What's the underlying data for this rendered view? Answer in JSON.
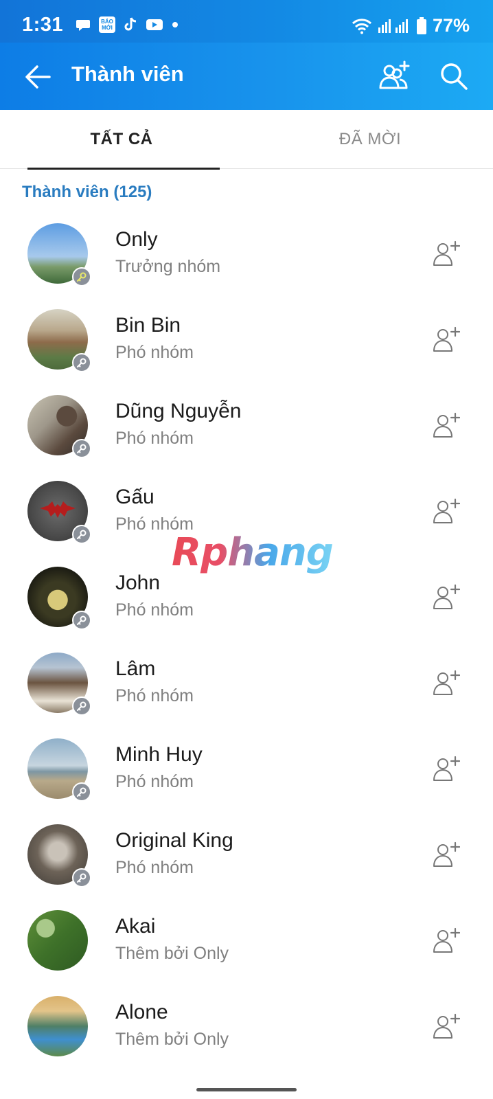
{
  "status_bar": {
    "time": "1:31",
    "battery": "77%",
    "notification_icons": [
      "chat-bubble-icon",
      "bao-moi-icon",
      "tiktok-icon",
      "youtube-icon",
      "dot-icon"
    ],
    "bao_moi_text": "BÁO MỚI"
  },
  "appbar": {
    "title": "Thành viên",
    "color": "#1389e4"
  },
  "tabs": [
    {
      "label": "TẤT CẢ",
      "selected": true
    },
    {
      "label": "ĐÃ MỜI",
      "selected": false
    }
  ],
  "section": {
    "title": "Thành viên (125)",
    "color": "#2a7cc0"
  },
  "members": [
    {
      "name": "Only",
      "role": "Trưởng nhóm",
      "badge": "key-icon",
      "avatar_colors": [
        "#5d9de2",
        "#a7c9ec",
        "#3f6a3a"
      ]
    },
    {
      "name": "Bin Bin",
      "role": "Phó nhóm",
      "badge": "key-icon",
      "avatar_colors": [
        "#c8c5b6",
        "#8d6b4b",
        "#4e6b3c"
      ]
    },
    {
      "name": "Dũng Nguyễn",
      "role": "Phó nhóm",
      "badge": "key-icon",
      "avatar_colors": [
        "#b9b4a4",
        "#5b4a3e",
        "#2f2a26"
      ]
    },
    {
      "name": "Gấu",
      "role": "Phó nhóm",
      "badge": "key-icon",
      "avatar_colors": [
        "#6b6b6b",
        "#3d3d3d",
        "#b51d1d"
      ]
    },
    {
      "name": "John",
      "role": "Phó nhóm",
      "badge": "key-icon",
      "avatar_colors": [
        "#1e1e14",
        "#3b3a22",
        "#d8c97a"
      ]
    },
    {
      "name": "Lâm",
      "role": "Phó nhóm",
      "badge": "key-icon",
      "avatar_colors": [
        "#8da9c7",
        "#6b5440",
        "#e9e3d6"
      ]
    },
    {
      "name": "Minh Huy",
      "role": "Phó nhóm",
      "badge": "key-icon",
      "avatar_colors": [
        "#8fb0c9",
        "#c7d5df",
        "#9b8b6d"
      ]
    },
    {
      "name": "Original King",
      "role": "Phó nhóm",
      "badge": "key-icon",
      "avatar_colors": [
        "#6d6358",
        "#3f3b36",
        "#c9c2b8"
      ]
    },
    {
      "name": "Akai",
      "role": "Thêm bởi Only",
      "badge": "",
      "avatar_colors": [
        "#5f8f3a",
        "#2e5a22",
        "#a9c98a"
      ]
    },
    {
      "name": "Alone",
      "role": "Thêm bởi Only",
      "badge": "",
      "avatar_colors": [
        "#d9b06a",
        "#4f7f66",
        "#3f8fcf"
      ]
    }
  ],
  "watermark": "Rphang"
}
